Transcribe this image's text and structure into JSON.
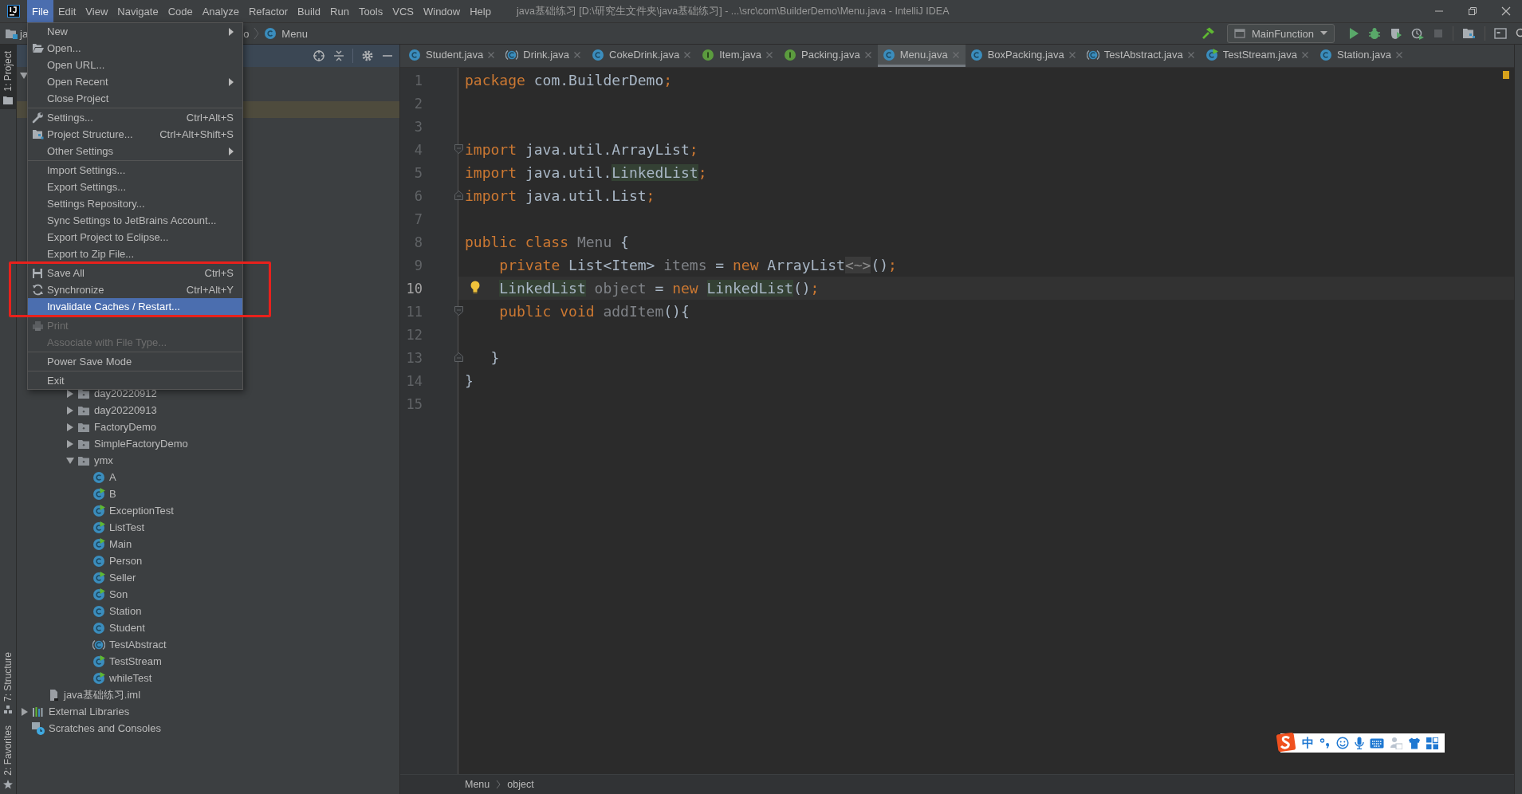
{
  "title_bar": {
    "menus": [
      {
        "label": "File",
        "selected": true
      },
      {
        "label": "Edit",
        "selected": false
      },
      {
        "label": "View",
        "selected": false
      },
      {
        "label": "Navigate",
        "selected": false
      },
      {
        "label": "Code",
        "selected": false
      },
      {
        "label": "Analyze",
        "selected": false
      },
      {
        "label": "Refactor",
        "selected": false
      },
      {
        "label": "Build",
        "selected": false
      },
      {
        "label": "Run",
        "selected": false
      },
      {
        "label": "Tools",
        "selected": false
      },
      {
        "label": "VCS",
        "selected": false
      },
      {
        "label": "Window",
        "selected": false
      },
      {
        "label": "Help",
        "selected": false
      }
    ],
    "title": "java基础练习 [D:\\研究生文件夹\\java基础练习] - ...\\src\\com\\BuilderDemo\\Menu.java - IntelliJ IDEA"
  },
  "nav_bar": {
    "crumbs": [
      {
        "label": "ja",
        "kind": "project"
      },
      {
        "label": "o",
        "kind": "package"
      },
      {
        "label": "Menu",
        "kind": "class"
      }
    ],
    "run_config": "MainFunction"
  },
  "tool_strip": [
    {
      "label": "1: Project",
      "selected": true,
      "kind": "top"
    },
    {
      "label": "7: Structure",
      "selected": false,
      "kind": "bottom"
    },
    {
      "label": "2: Favorites",
      "selected": false,
      "kind": "bottom"
    }
  ],
  "project_panel": {
    "root_expanded": true,
    "selection_strip": true
  },
  "project_tree": [
    {
      "children": [
        {
          "children": [
            {
              "children": [
                {
                  "label": "day20220912",
                  "kind": "folder",
                  "expanded": false
                },
                {
                  "label": "day20220913",
                  "kind": "folder",
                  "expanded": false
                },
                {
                  "label": "FactoryDemo",
                  "kind": "folder",
                  "expanded": false
                },
                {
                  "label": "SimpleFactoryDemo",
                  "kind": "folder",
                  "expanded": false
                },
                {
                  "label": "ymx",
                  "kind": "folder",
                  "expanded": true,
                  "children": [
                    {
                      "label": "A",
                      "kind": "class"
                    },
                    {
                      "label": "B",
                      "kind": "runnable"
                    },
                    {
                      "label": "ExceptionTest",
                      "kind": "runnable"
                    },
                    {
                      "label": "ListTest",
                      "kind": "runnable"
                    },
                    {
                      "label": "Main",
                      "kind": "runnable"
                    },
                    {
                      "label": "Person",
                      "kind": "class"
                    },
                    {
                      "label": "Seller",
                      "kind": "runnable"
                    },
                    {
                      "label": "Son",
                      "kind": "runnable"
                    },
                    {
                      "label": "Station",
                      "kind": "class"
                    },
                    {
                      "label": "Student",
                      "kind": "class"
                    },
                    {
                      "label": "TestAbstract",
                      "kind": "abstract"
                    },
                    {
                      "label": "TestStream",
                      "kind": "runnable"
                    },
                    {
                      "label": "whileTest",
                      "kind": "runnable"
                    }
                  ]
                }
              ]
            }
          ]
        },
        {
          "label": "java基础练习.iml",
          "kind": "module"
        }
      ]
    },
    {
      "label": "External Libraries",
      "kind": "library",
      "expanded": false
    },
    {
      "label": "Scratches and Consoles",
      "kind": "scratches"
    }
  ],
  "editor": {
    "tabs": [
      {
        "label": "Student.java",
        "kind": "class",
        "selected": false
      },
      {
        "label": "Drink.java",
        "kind": "abstract",
        "selected": false
      },
      {
        "label": "CokeDrink.java",
        "kind": "class",
        "selected": false
      },
      {
        "label": "Item.java",
        "kind": "interface",
        "selected": false
      },
      {
        "label": "Packing.java",
        "kind": "interface",
        "selected": false
      },
      {
        "label": "Menu.java",
        "kind": "class",
        "selected": true
      },
      {
        "label": "BoxPacking.java",
        "kind": "class",
        "selected": false
      },
      {
        "label": "TestAbstract.java",
        "kind": "abstract",
        "selected": false
      },
      {
        "label": "TestStream.java",
        "kind": "runnable",
        "selected": false
      },
      {
        "label": "Station.java",
        "kind": "class",
        "selected": false
      }
    ],
    "lines": [
      {
        "number": "1",
        "current": false,
        "kind": "plain",
        "tokens": [
          {
            "text": "package",
            "kind": "keyword"
          },
          {
            "text": " com.BuilderDemo",
            "kind": "plain"
          },
          {
            "text": ";",
            "kind": "keyword"
          }
        ]
      },
      {
        "number": "2",
        "current": false,
        "kind": "plain"
      },
      {
        "number": "3",
        "current": false,
        "kind": "plain"
      },
      {
        "number": "4",
        "current": false,
        "kind": "fold_start",
        "tokens": [
          {
            "text": "import",
            "kind": "keyword"
          },
          {
            "text": " java.util.ArrayList",
            "kind": "plain"
          },
          {
            "text": ";",
            "kind": "keyword"
          }
        ]
      },
      {
        "number": "5",
        "current": false,
        "kind": "plain",
        "tokens": [
          {
            "text": "import",
            "kind": "keyword"
          },
          {
            "text": " java.util.",
            "kind": "plain"
          },
          {
            "text": "LinkedList",
            "kind": "usage"
          },
          {
            "text": ";",
            "kind": "keyword"
          }
        ]
      },
      {
        "number": "6",
        "current": false,
        "kind": "fold_end",
        "tokens": [
          {
            "text": "import",
            "kind": "keyword"
          },
          {
            "text": " java.util.List",
            "kind": "plain"
          },
          {
            "text": ";",
            "kind": "keyword"
          }
        ]
      },
      {
        "number": "7",
        "current": false,
        "kind": "plain"
      },
      {
        "number": "8",
        "current": false,
        "kind": "plain",
        "tokens": [
          {
            "text": "public class",
            "kind": "keyword"
          },
          {
            "text": " Menu",
            "kind": "unused"
          },
          {
            "text": " {",
            "kind": "plain"
          }
        ]
      },
      {
        "number": "9",
        "current": false,
        "kind": "plain",
        "tokens": [
          {
            "text": "    private",
            "kind": "keyword"
          },
          {
            "text": " List<Item> ",
            "kind": "plain"
          },
          {
            "text": "items",
            "kind": "unused"
          },
          {
            "text": " = ",
            "kind": "plain"
          },
          {
            "text": "new",
            "kind": "keyword"
          },
          {
            "text": " ArrayList",
            "kind": "plain"
          },
          {
            "text": "<~>",
            "kind": "folded"
          },
          {
            "text": "()",
            "kind": "plain"
          },
          {
            "text": ";",
            "kind": "keyword"
          }
        ]
      },
      {
        "number": "10",
        "current": true,
        "kind": "bulb",
        "tokens": [
          {
            "text": "    LinkedList",
            "kind": "usage"
          },
          {
            "text": " object",
            "kind": "unused"
          },
          {
            "text": " = ",
            "kind": "plain"
          },
          {
            "text": "new",
            "kind": "keyword"
          },
          {
            "text": " LinkedList",
            "kind": "usage"
          },
          {
            "text": "()",
            "kind": "plain"
          },
          {
            "text": ";",
            "kind": "keyword"
          }
        ]
      },
      {
        "number": "11",
        "current": false,
        "kind": "fold_start",
        "tokens": [
          {
            "text": "    public void",
            "kind": "keyword"
          },
          {
            "text": " addItem",
            "kind": "unused"
          },
          {
            "text": "(){",
            "kind": "plain"
          }
        ]
      },
      {
        "number": "12",
        "current": false,
        "kind": "plain"
      },
      {
        "number": "13",
        "current": false,
        "kind": "fold_end",
        "tokens": [
          {
            "text": "   }",
            "kind": "plain"
          }
        ]
      },
      {
        "number": "14",
        "current": false,
        "kind": "plain",
        "tokens": [
          {
            "text": "}",
            "kind": "plain"
          }
        ]
      },
      {
        "number": "15",
        "current": false,
        "kind": "plain"
      }
    ],
    "breadcrumbs": [
      "Menu",
      "object"
    ]
  },
  "file_menu": [
    {
      "kind": "item",
      "label": "New",
      "submenu": true,
      "disabled": false,
      "selected": false
    },
    {
      "kind": "item",
      "label": "Open...",
      "submenu": false,
      "disabled": false,
      "selected": false
    },
    {
      "kind": "item",
      "label": "Open URL...",
      "submenu": false,
      "disabled": false,
      "selected": false
    },
    {
      "kind": "item",
      "label": "Open Recent",
      "submenu": true,
      "disabled": false,
      "selected": false
    },
    {
      "kind": "item",
      "label": "Close Project",
      "submenu": false,
      "disabled": false,
      "selected": false
    },
    {
      "kind": "separator"
    },
    {
      "kind": "item",
      "label": "Settings...",
      "shortcut": "Ctrl+Alt+S",
      "submenu": false,
      "disabled": false,
      "selected": false
    },
    {
      "kind": "item",
      "label": "Project Structure...",
      "shortcut": "Ctrl+Alt+Shift+S",
      "submenu": false,
      "disabled": false,
      "selected": false
    },
    {
      "kind": "item",
      "label": "Other Settings",
      "submenu": true,
      "disabled": false,
      "selected": false
    },
    {
      "kind": "separator"
    },
    {
      "kind": "item",
      "label": "Import Settings...",
      "submenu": false,
      "disabled": false,
      "selected": false
    },
    {
      "kind": "item",
      "label": "Export Settings...",
      "submenu": false,
      "disabled": false,
      "selected": false
    },
    {
      "kind": "item",
      "label": "Settings Repository...",
      "submenu": false,
      "disabled": false,
      "selected": false
    },
    {
      "kind": "item",
      "label": "Sync Settings to JetBrains Account...",
      "submenu": false,
      "disabled": false,
      "selected": false
    },
    {
      "kind": "item",
      "label": "Export Project to Eclipse...",
      "submenu": false,
      "disabled": false,
      "selected": false
    },
    {
      "kind": "item",
      "label": "Export to Zip File...",
      "submenu": false,
      "disabled": false,
      "selected": false
    },
    {
      "kind": "separator"
    },
    {
      "kind": "item",
      "label": "Save All",
      "shortcut": "Ctrl+S",
      "submenu": false,
      "disabled": false,
      "selected": false
    },
    {
      "kind": "item",
      "label": "Synchronize",
      "shortcut": "Ctrl+Alt+Y",
      "submenu": false,
      "disabled": false,
      "selected": false
    },
    {
      "kind": "item",
      "label": "Invalidate Caches / Restart...",
      "submenu": false,
      "disabled": false,
      "selected": true
    },
    {
      "kind": "separator"
    },
    {
      "kind": "item",
      "label": "Print",
      "submenu": false,
      "disabled": true,
      "selected": false
    },
    {
      "kind": "item",
      "label": "Associate with File Type...",
      "submenu": false,
      "disabled": true,
      "selected": false
    },
    {
      "kind": "separator"
    },
    {
      "kind": "item",
      "label": "Power Save Mode",
      "submenu": false,
      "disabled": false,
      "selected": false
    },
    {
      "kind": "separator"
    },
    {
      "kind": "item",
      "label": "Exit",
      "submenu": false,
      "disabled": false,
      "selected": false
    }
  ],
  "ime_bar": {
    "mode": "中"
  }
}
